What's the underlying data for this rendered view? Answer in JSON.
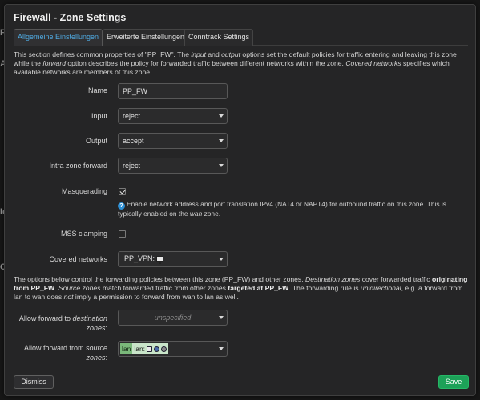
{
  "backdrop": {
    "edge_fragments": [
      "Fi",
      "All",
      "Ic",
      "Co"
    ]
  },
  "dialog": {
    "title": "Firewall - Zone Settings"
  },
  "tabs": [
    {
      "label": "Allgemeine Einstellungen",
      "active": true
    },
    {
      "label": "Erweiterte Einstellungen",
      "active": false
    },
    {
      "label": "Conntrack Settings",
      "active": false
    }
  ],
  "intro": {
    "t1": "This section defines common properties of \"PP_FW\". The ",
    "i1": "input",
    "t2": " and ",
    "i2": "output",
    "t3": " options set the default policies for traffic entering and leaving this zone while the ",
    "i3": "forward",
    "t4": " option describes the policy for forwarded traffic between different networks within the zone. ",
    "i4": "Covered networks",
    "t5": " specifies which available networks are members of this zone."
  },
  "form": {
    "name": {
      "label": "Name",
      "value": "PP_FW"
    },
    "input": {
      "label": "Input",
      "value": "reject"
    },
    "output": {
      "label": "Output",
      "value": "accept"
    },
    "intra_zone_forward": {
      "label": "Intra zone forward",
      "value": "reject"
    },
    "masquerading": {
      "label": "Masquerading",
      "checked": true,
      "help_t1": "Enable network address and port translation IPv4 (NAT4 or NAPT4) for outbound traffic on this zone. This is typically enabled on the ",
      "help_i1": "wan",
      "help_t2": " zone."
    },
    "mss_clamping": {
      "label": "MSS clamping",
      "checked": false
    },
    "covered_networks": {
      "label": "Covered networks",
      "value": "PP_VPN:",
      "icon": "network-interface-icon"
    }
  },
  "forwarding": {
    "t1": "The options below control the forwarding policies between this zone (PP_FW) and other zones. ",
    "i1": "Destination zones",
    "t2": " cover forwarded traffic ",
    "b1": "originating from PP_FW",
    "t3": ". ",
    "i2": "Source zones",
    "t4": " match forwarded traffic from other zones ",
    "b2": "targeted at PP_FW",
    "t5": ". The forwarding rule is ",
    "i3": "unidirectional",
    "t6": ", e.g. a forward from lan to wan does ",
    "i4": "not",
    "t7": " imply a permission to forward from wan to lan as well.",
    "dest": {
      "label_t": "Allow forward to ",
      "label_i": "destination zones",
      "label_end": ":",
      "placeholder": "unspecified"
    },
    "source": {
      "label_t": "Allow forward from ",
      "label_i": "source zones",
      "label_end": ":",
      "zone_tag": "lan",
      "zone_body": "lan:"
    }
  },
  "footer": {
    "dismiss": "Dismiss",
    "save": "Save"
  },
  "colors": {
    "accent": "#4fa9e0",
    "save": "#1da158",
    "zone_lan": "#c9e5c9"
  }
}
